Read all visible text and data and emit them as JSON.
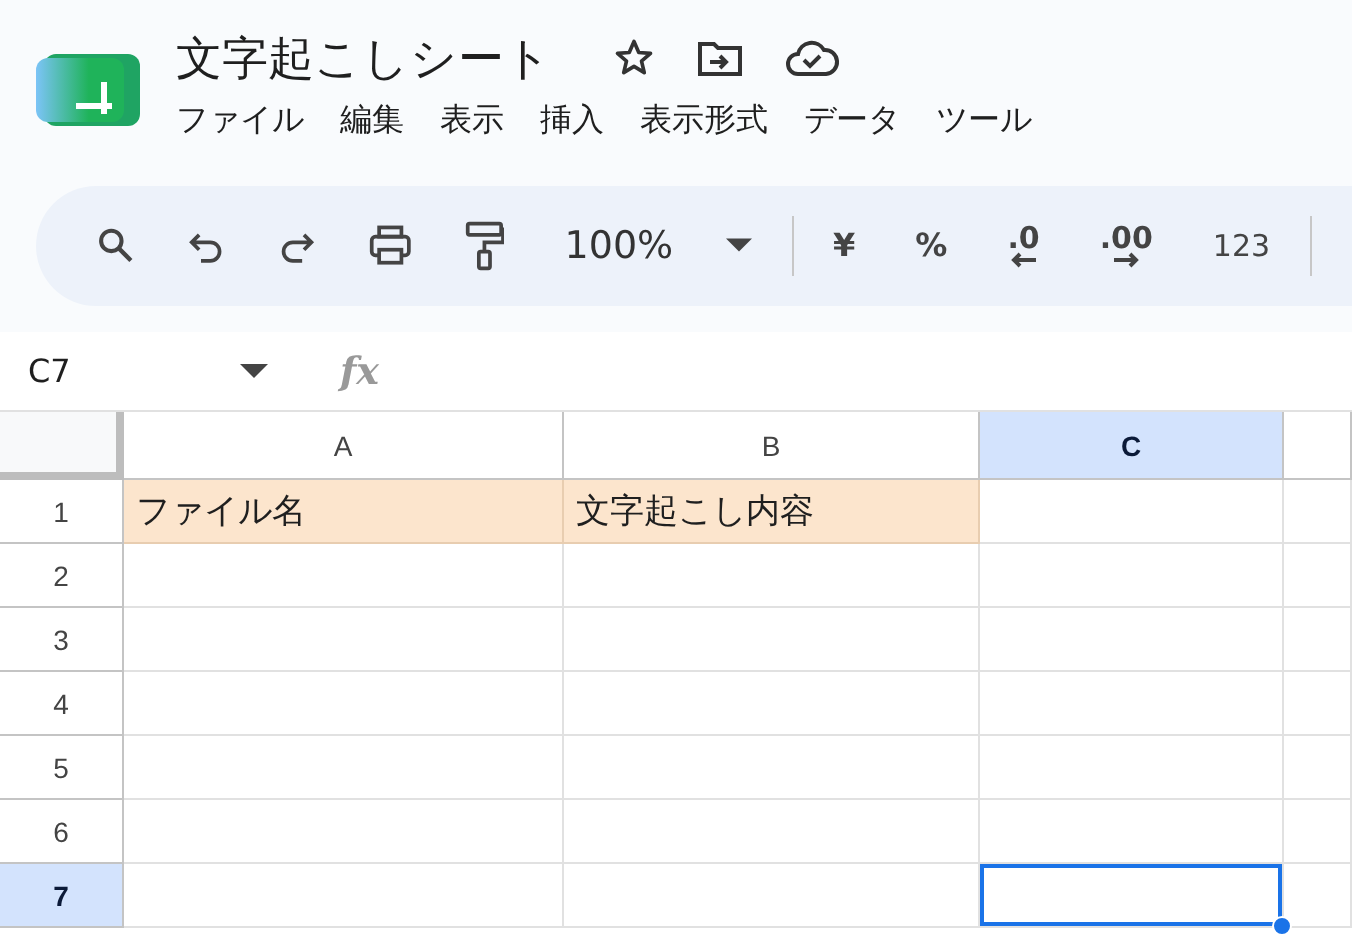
{
  "document": {
    "title": "文字起こしシート"
  },
  "menu": [
    "ファイル",
    "編集",
    "表示",
    "挿入",
    "表示形式",
    "データ",
    "ツール"
  ],
  "toolbar": {
    "zoom": "100%",
    "currency": "¥",
    "percent": "%",
    "decimal_decrease": ".0",
    "decimal_increase": ".00",
    "number_format": "123"
  },
  "formula_bar": {
    "cell_ref": "C7",
    "fx": "fx"
  },
  "sheet": {
    "columns": [
      {
        "label": "A",
        "selected": false
      },
      {
        "label": "B",
        "selected": false
      },
      {
        "label": "C",
        "selected": true
      }
    ],
    "rows": [
      {
        "label": "1",
        "selected": false,
        "cells": [
          {
            "text": "ファイル名",
            "highlighted": true,
            "selected": false
          },
          {
            "text": "文字起こし内容",
            "highlighted": true,
            "selected": false
          },
          {
            "text": "",
            "highlighted": false,
            "selected": false
          }
        ]
      },
      {
        "label": "2",
        "selected": false,
        "cells": [
          {
            "text": "",
            "highlighted": false,
            "selected": false
          },
          {
            "text": "",
            "highlighted": false,
            "selected": false
          },
          {
            "text": "",
            "highlighted": false,
            "selected": false
          }
        ]
      },
      {
        "label": "3",
        "selected": false,
        "cells": [
          {
            "text": "",
            "highlighted": false,
            "selected": false
          },
          {
            "text": "",
            "highlighted": false,
            "selected": false
          },
          {
            "text": "",
            "highlighted": false,
            "selected": false
          }
        ]
      },
      {
        "label": "4",
        "selected": false,
        "cells": [
          {
            "text": "",
            "highlighted": false,
            "selected": false
          },
          {
            "text": "",
            "highlighted": false,
            "selected": false
          },
          {
            "text": "",
            "highlighted": false,
            "selected": false
          }
        ]
      },
      {
        "label": "5",
        "selected": false,
        "cells": [
          {
            "text": "",
            "highlighted": false,
            "selected": false
          },
          {
            "text": "",
            "highlighted": false,
            "selected": false
          },
          {
            "text": "",
            "highlighted": false,
            "selected": false
          }
        ]
      },
      {
        "label": "6",
        "selected": false,
        "cells": [
          {
            "text": "",
            "highlighted": false,
            "selected": false
          },
          {
            "text": "",
            "highlighted": false,
            "selected": false
          },
          {
            "text": "",
            "highlighted": false,
            "selected": false
          }
        ]
      },
      {
        "label": "7",
        "selected": true,
        "cells": [
          {
            "text": "",
            "highlighted": false,
            "selected": false
          },
          {
            "text": "",
            "highlighted": false,
            "selected": false
          },
          {
            "text": "",
            "highlighted": false,
            "selected": true
          }
        ]
      }
    ]
  }
}
